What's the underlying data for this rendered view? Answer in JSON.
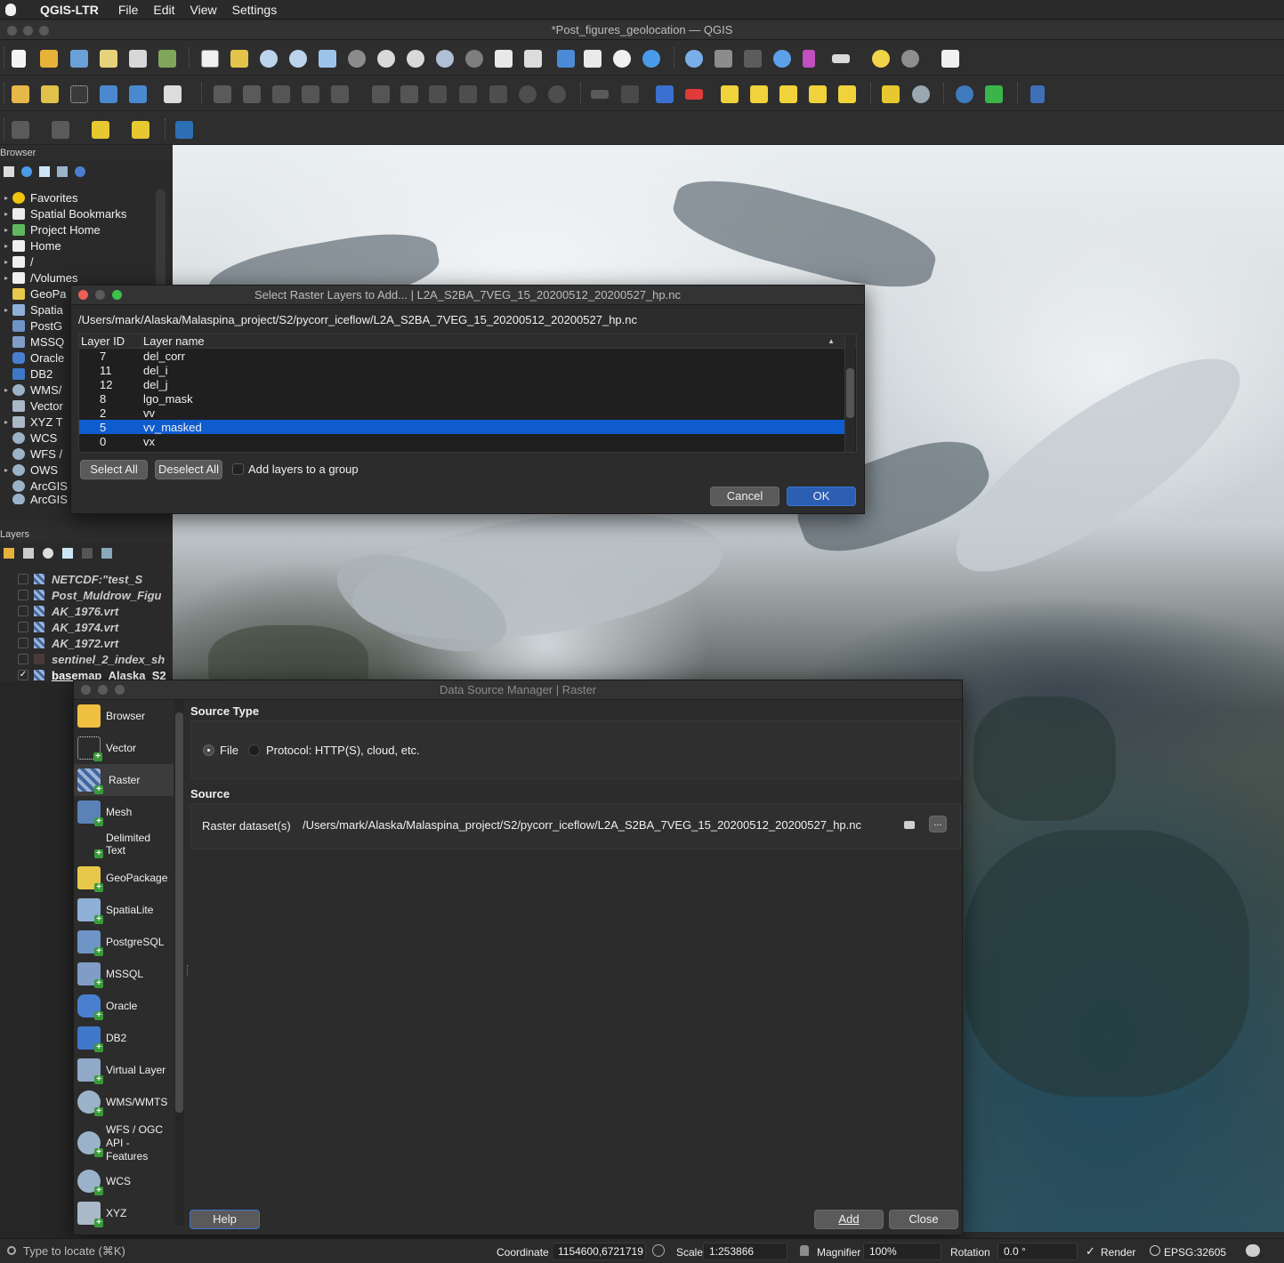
{
  "menubar": {
    "app": "QGIS-LTR",
    "items": [
      "File",
      "Edit",
      "View",
      "Settings"
    ]
  },
  "window": {
    "title": "*Post_figures_geolocation — QGIS"
  },
  "browser": {
    "title": "Browser",
    "items": [
      {
        "label": "Favorites",
        "icon": "star-icon"
      },
      {
        "label": "Spatial Bookmarks",
        "icon": "bookmarks-icon"
      },
      {
        "label": "Project Home",
        "icon": "project-home-icon"
      },
      {
        "label": "Home",
        "icon": "home-icon"
      },
      {
        "label": "/",
        "icon": "folder-icon"
      },
      {
        "label": "/Volumes",
        "icon": "folder-icon"
      },
      {
        "label": "GeoPa",
        "icon": "geopackage-icon"
      },
      {
        "label": "Spatia",
        "icon": "spatialite-icon"
      },
      {
        "label": "PostG",
        "icon": "postgresql-icon"
      },
      {
        "label": "MSSQ",
        "icon": "mssql-icon"
      },
      {
        "label": "Oracle",
        "icon": "oracle-icon"
      },
      {
        "label": "DB2",
        "icon": "db2-icon"
      },
      {
        "label": "WMS/",
        "icon": "wms-icon"
      },
      {
        "label": "Vector",
        "icon": "vector-tiles-icon"
      },
      {
        "label": "XYZ T",
        "icon": "xyz-icon"
      },
      {
        "label": "WCS",
        "icon": "wcs-icon"
      },
      {
        "label": "WFS /",
        "icon": "wfs-icon"
      },
      {
        "label": "OWS",
        "icon": "ows-icon"
      },
      {
        "label": "ArcGIS",
        "icon": "arcgis-icon"
      },
      {
        "label": "ArcGIS",
        "icon": "arcgis-icon"
      }
    ]
  },
  "layers": {
    "title": "Layers",
    "items": [
      {
        "label": "NETCDF:\"test_S",
        "checked": false
      },
      {
        "label": "Post_Muldrow_Figu",
        "checked": false
      },
      {
        "label": "AK_1976.vrt",
        "checked": false
      },
      {
        "label": "AK_1974.vrt",
        "checked": false
      },
      {
        "label": "AK_1972.vrt",
        "checked": false
      },
      {
        "label": "sentinel_2_index_sh",
        "checked": false
      },
      {
        "label": "basemap_Alaska_S2",
        "checked": true
      }
    ]
  },
  "raster_select": {
    "title": "Select Raster Layers to Add... | L2A_S2BA_7VEG_15_20200512_20200527_hp.nc",
    "path": "/Users/mark/Alaska/Malaspina_project/S2/pycorr_iceflow/L2A_S2BA_7VEG_15_20200512_20200527_hp.nc",
    "col_id": "Layer ID",
    "col_name": "Layer name",
    "rows": [
      {
        "id": "7",
        "name": "del_corr"
      },
      {
        "id": "11",
        "name": "del_i"
      },
      {
        "id": "12",
        "name": "del_j"
      },
      {
        "id": "8",
        "name": "lgo_mask"
      },
      {
        "id": "2",
        "name": "vv"
      },
      {
        "id": "5",
        "name": "vv_masked"
      },
      {
        "id": "0",
        "name": "vx"
      }
    ],
    "select_all": "Select All",
    "deselect_all": "Deselect All",
    "add_group": "Add layers to a group",
    "cancel": "Cancel",
    "ok": "OK"
  },
  "dsm": {
    "title": "Data Source Manager | Raster",
    "sidebar": [
      {
        "label": "Browser",
        "icon": "folder-icon"
      },
      {
        "label": "Vector",
        "icon": "vector-icon"
      },
      {
        "label": "Raster",
        "icon": "raster-icon"
      },
      {
        "label": "Mesh",
        "icon": "mesh-icon"
      },
      {
        "label": "Delimited Text",
        "icon": "delimited-text-icon"
      },
      {
        "label": "GeoPackage",
        "icon": "geopackage-icon"
      },
      {
        "label": "SpatiaLite",
        "icon": "spatialite-icon"
      },
      {
        "label": "PostgreSQL",
        "icon": "postgresql-icon"
      },
      {
        "label": "MSSQL",
        "icon": "mssql-icon"
      },
      {
        "label": "Oracle",
        "icon": "oracle-icon"
      },
      {
        "label": "DB2",
        "icon": "db2-icon"
      },
      {
        "label": "Virtual Layer",
        "icon": "virtual-layer-icon"
      },
      {
        "label": "WMS/WMTS",
        "icon": "wms-icon"
      },
      {
        "label": "WFS / OGC API - Features",
        "icon": "wfs-icon"
      },
      {
        "label": "WCS",
        "icon": "wcs-icon"
      },
      {
        "label": "XYZ",
        "icon": "xyz-icon"
      }
    ],
    "source_type_label": "Source Type",
    "file_label": "File",
    "protocol_label": "Protocol: HTTP(S), cloud, etc.",
    "source_label": "Source",
    "raster_dataset_label": "Raster dataset(s)",
    "raster_dataset_value": "/Users/mark/Alaska/Malaspina_project/S2/pycorr_iceflow/L2A_S2BA_7VEG_15_20200512_20200527_hp.nc",
    "browse": "...",
    "help": "Help",
    "add": "Add",
    "close": "Close"
  },
  "status": {
    "locate_placeholder": "Type to locate (⌘K)",
    "coordinate_label": "Coordinate",
    "coordinate_value": "1154600,6721719",
    "scale_label": "Scale",
    "scale_value": "1:253866",
    "magnifier_label": "Magnifier",
    "magnifier_value": "100%",
    "rotation_label": "Rotation",
    "rotation_value": "0.0 °",
    "render_label": "Render",
    "crs": "EPSG:32605"
  },
  "colors": {
    "accent": "#0f5ccf",
    "ok_button": "#2c5fb3",
    "window_bg": "#2c2c2c"
  }
}
